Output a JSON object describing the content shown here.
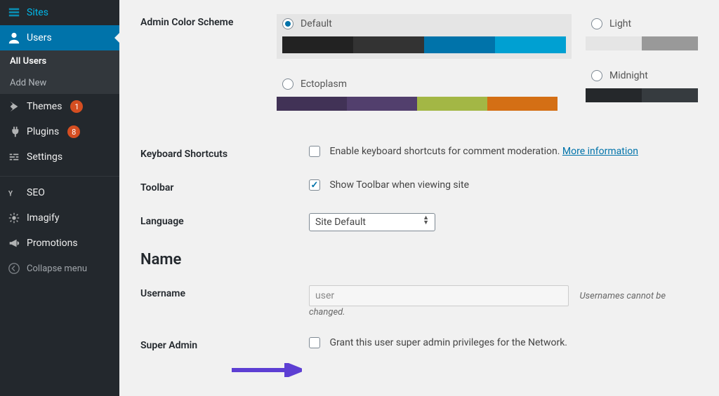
{
  "sidebar": {
    "items": [
      {
        "label": "Sites",
        "icon": "sites"
      },
      {
        "label": "Users",
        "icon": "users",
        "current": true
      },
      {
        "label": "Themes",
        "icon": "themes",
        "badge": "1"
      },
      {
        "label": "Plugins",
        "icon": "plugins",
        "badge": "8"
      },
      {
        "label": "Settings",
        "icon": "settings"
      },
      {
        "label": "SEO",
        "icon": "seo"
      },
      {
        "label": "Imagify",
        "icon": "imagify"
      },
      {
        "label": "Promotions",
        "icon": "promotions"
      }
    ],
    "submenu": [
      {
        "label": "All Users",
        "current": true
      },
      {
        "label": "Add New"
      }
    ],
    "collapse": "Collapse menu"
  },
  "form": {
    "color_scheme_label": "Admin Color Scheme",
    "schemes_col1": [
      {
        "name": "Default",
        "selected": true,
        "colors": [
          "#222",
          "#333",
          "#0073aa",
          "#00a0d2"
        ]
      },
      {
        "name": "Ectoplasm",
        "colors": [
          "#413256",
          "#523f6d",
          "#a3b745",
          "#d46f15"
        ]
      }
    ],
    "schemes_col2": [
      {
        "name": "Light",
        "colors": [
          "#e5e5e5",
          "#999"
        ]
      },
      {
        "name": "Midnight",
        "colors": [
          "#25282b",
          "#363b3f"
        ]
      }
    ],
    "keyboard_label": "Keyboard Shortcuts",
    "keyboard_cb": "Enable keyboard shortcuts for comment moderation.",
    "keyboard_more": "More information",
    "toolbar_label": "Toolbar",
    "toolbar_cb": "Show Toolbar when viewing site",
    "language_label": "Language",
    "language_value": "Site Default",
    "section_name": "Name",
    "username_label": "Username",
    "username_value": "user",
    "username_desc": "Usernames cannot be changed.",
    "superadmin_label": "Super Admin",
    "superadmin_cb": "Grant this user super admin privileges for the Network."
  }
}
